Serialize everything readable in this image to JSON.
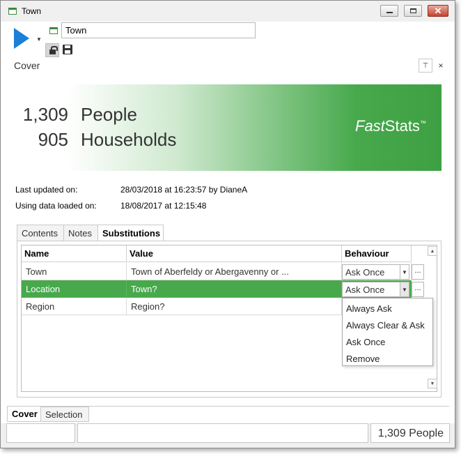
{
  "window": {
    "title": "Town"
  },
  "toolbar": {
    "name_value": "Town"
  },
  "panel": {
    "title": "Cover",
    "pin_glyph": "📌",
    "close_glyph": "×"
  },
  "banner": {
    "people_count": "1,309",
    "people_label": "People",
    "households_count": "905",
    "households_label": "Households",
    "logo_fast": "Fast",
    "logo_stats": "Stats",
    "logo_tm": "™"
  },
  "info": {
    "last_updated_label": "Last updated on:",
    "last_updated_value": "28/03/2018 at 16:23:57 by DianeA",
    "data_loaded_label": "Using data loaded on:",
    "data_loaded_value": "18/08/2017 at 12:15:48"
  },
  "tabs": [
    {
      "label": "Contents"
    },
    {
      "label": "Notes"
    },
    {
      "label": "Substitutions"
    }
  ],
  "grid": {
    "headers": [
      "Name",
      "Value",
      "Behaviour"
    ],
    "rows": [
      {
        "name": "Town",
        "value": "Town of Aberfeldy or Abergavenny or ...",
        "behaviour": "Ask Once",
        "more": "..."
      },
      {
        "name": "Location",
        "value": "Town?",
        "behaviour": "Ask Once",
        "more": "..."
      },
      {
        "name": "Region",
        "value": "Region?"
      }
    ],
    "dropdown_options": [
      "Always Ask",
      "Always Clear & Ask",
      "Ask Once",
      "Remove"
    ]
  },
  "bottom_tabs": [
    {
      "label": "Cover"
    },
    {
      "label": "Selection"
    }
  ],
  "statusbar": {
    "right_text": "1,309 People"
  },
  "colors": {
    "accent_green": "#47a94c",
    "play_blue": "#1b7fd6"
  }
}
